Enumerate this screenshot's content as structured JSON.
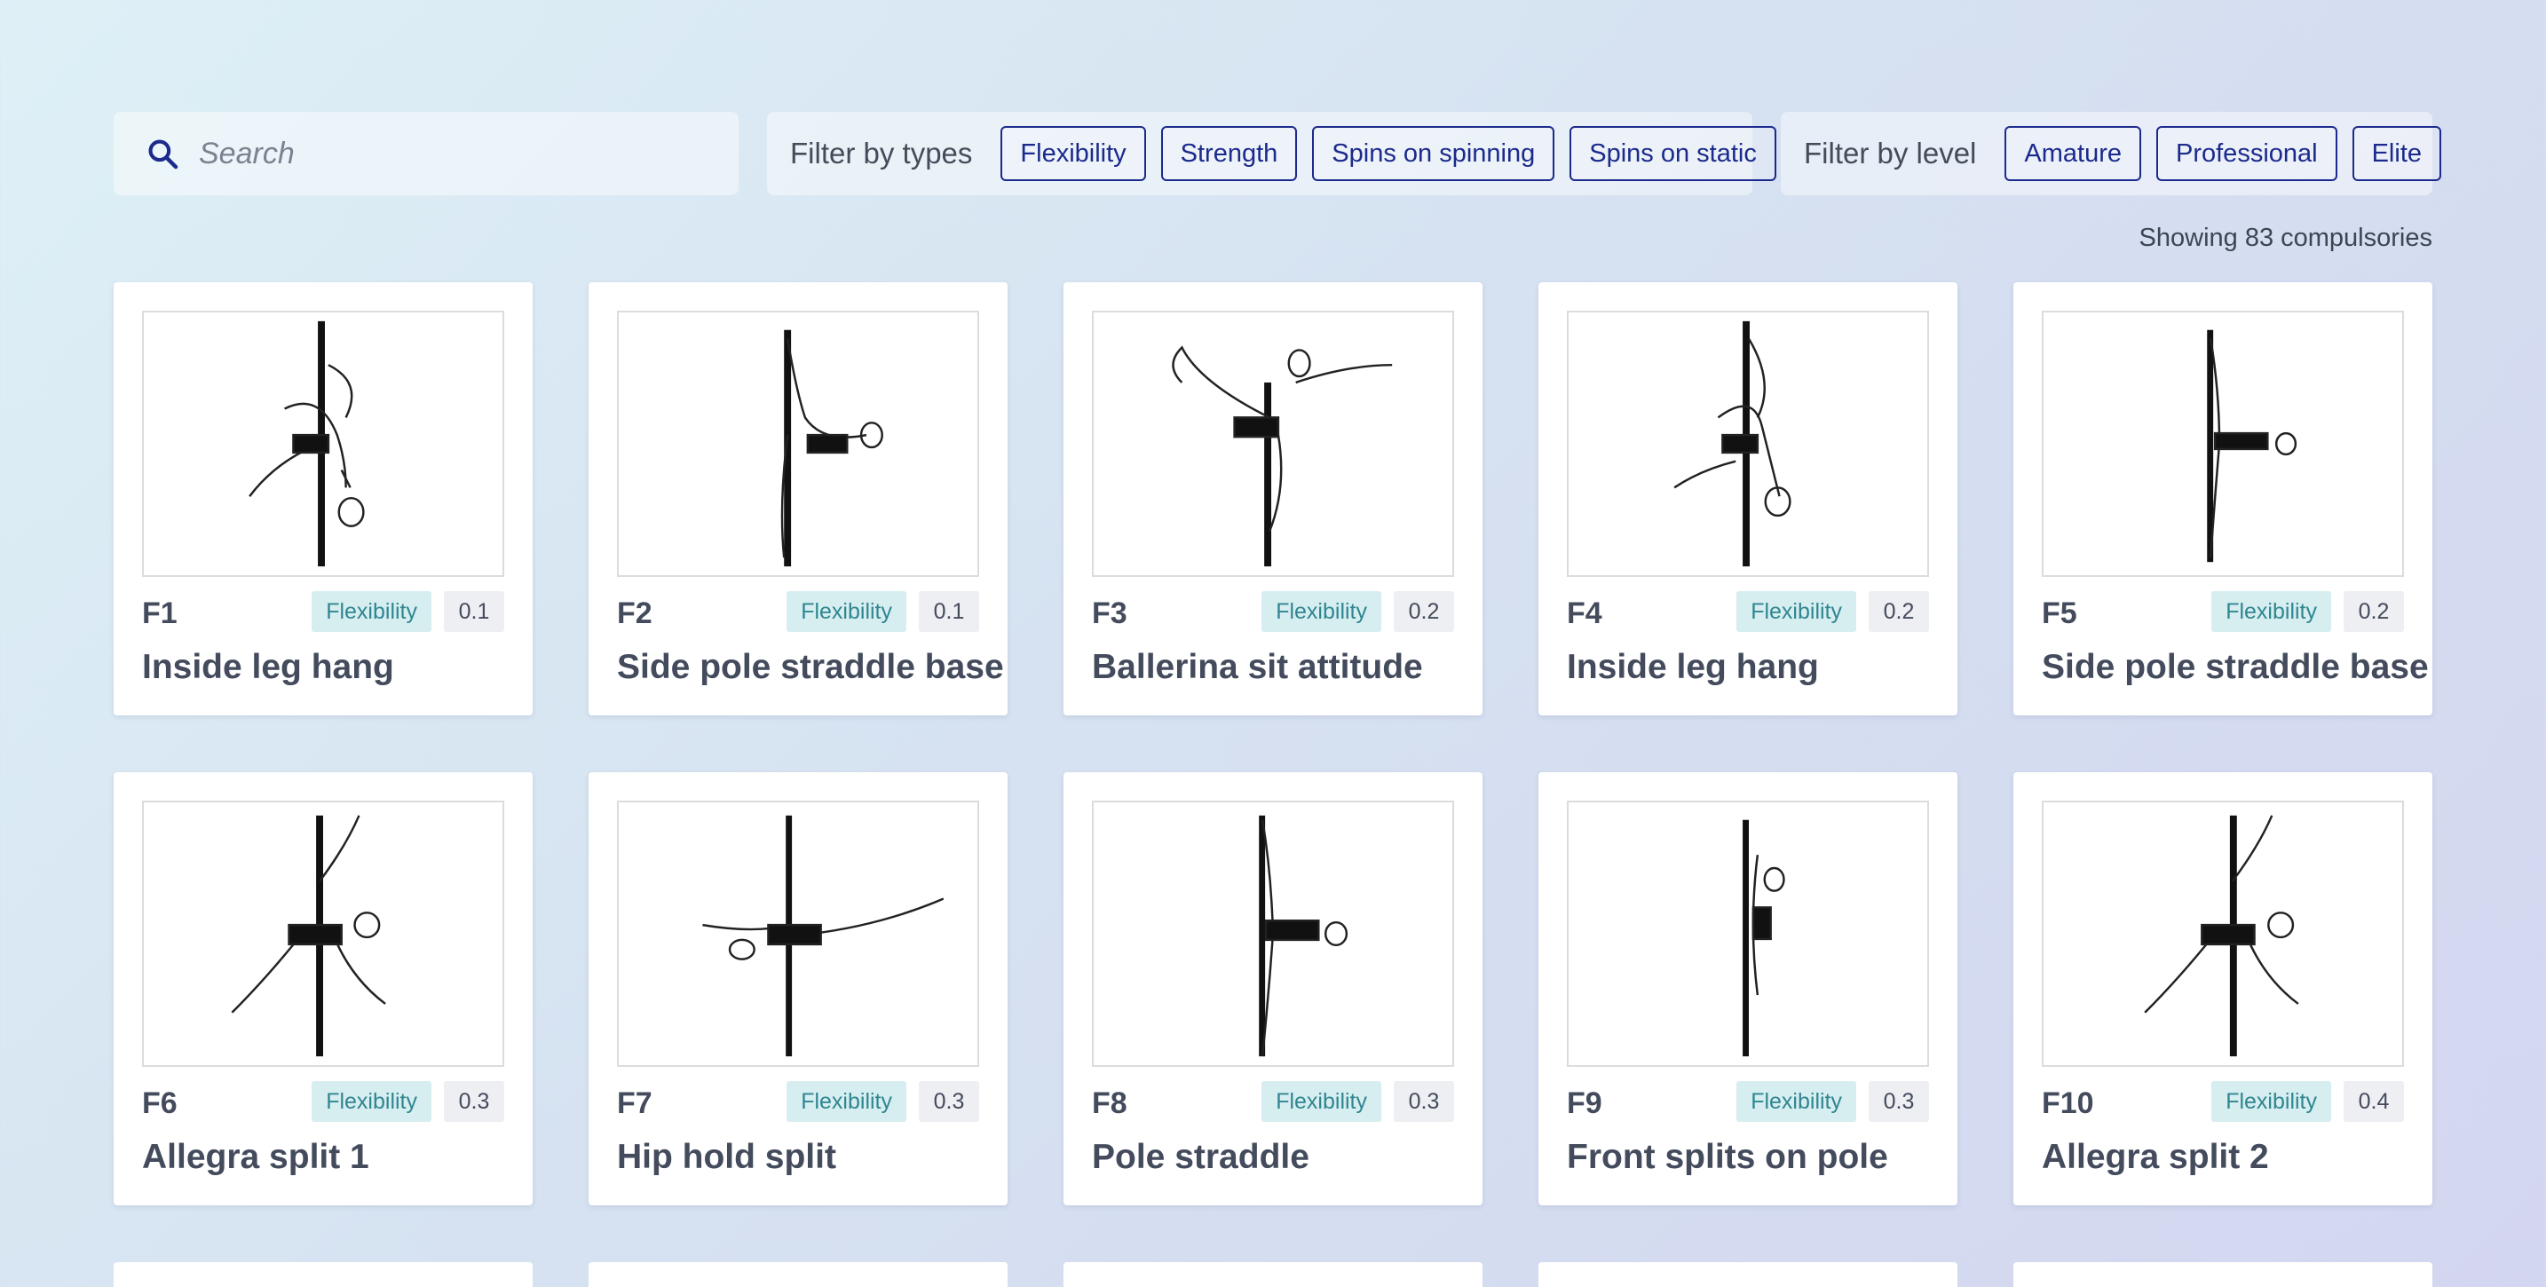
{
  "search": {
    "placeholder": "Search"
  },
  "filters": {
    "types_label": "Filter by types",
    "types": [
      "Flexibility",
      "Strength",
      "Spins on spinning",
      "Spins on static"
    ],
    "level_label": "Filter by level",
    "levels": [
      "Amature",
      "Professional",
      "Elite"
    ]
  },
  "results": {
    "count_text": "Showing 83 compulsories"
  },
  "cards": [
    {
      "code": "F1",
      "type": "Flexibility",
      "value": "0.1",
      "name": "Inside leg hang"
    },
    {
      "code": "F2",
      "type": "Flexibility",
      "value": "0.1",
      "name": "Side pole straddle base"
    },
    {
      "code": "F3",
      "type": "Flexibility",
      "value": "0.2",
      "name": "Ballerina sit attitude"
    },
    {
      "code": "F4",
      "type": "Flexibility",
      "value": "0.2",
      "name": "Inside leg hang"
    },
    {
      "code": "F5",
      "type": "Flexibility",
      "value": "0.2",
      "name": "Side pole straddle base"
    },
    {
      "code": "F6",
      "type": "Flexibility",
      "value": "0.3",
      "name": "Allegra split 1"
    },
    {
      "code": "F7",
      "type": "Flexibility",
      "value": "0.3",
      "name": "Hip hold split"
    },
    {
      "code": "F8",
      "type": "Flexibility",
      "value": "0.3",
      "name": "Pole straddle"
    },
    {
      "code": "F9",
      "type": "Flexibility",
      "value": "0.3",
      "name": "Front splits on pole"
    },
    {
      "code": "F10",
      "type": "Flexibility",
      "value": "0.4",
      "name": "Allegra split 2"
    }
  ],
  "colors": {
    "accent": "#1b2a8c",
    "badge_bg": "#d7eef1",
    "badge_text": "#2f8690",
    "card_text": "#434b5c"
  },
  "icons": {
    "search": "search-icon"
  }
}
